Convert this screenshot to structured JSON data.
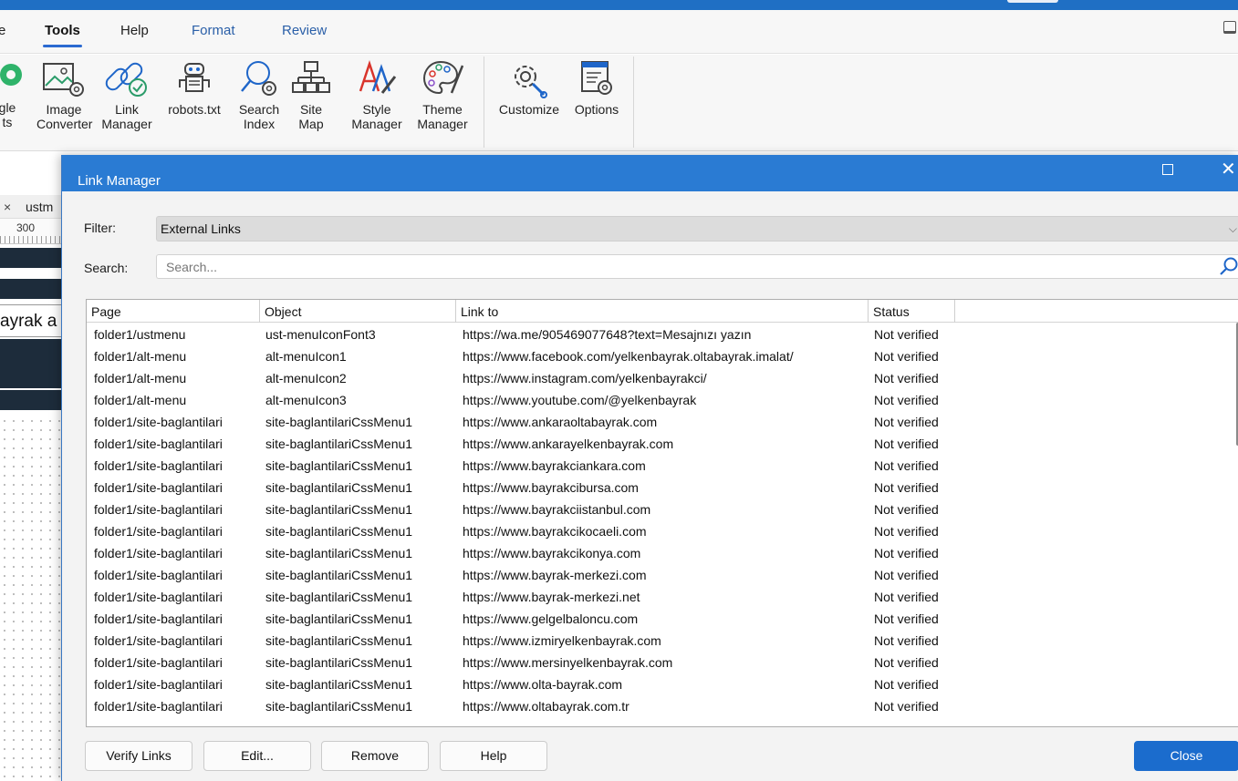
{
  "menu": {
    "tabs": [
      {
        "label": "e"
      },
      {
        "label": "Tools"
      },
      {
        "label": "Help"
      },
      {
        "label": "Format"
      },
      {
        "label": "Review"
      }
    ]
  },
  "ribbon": {
    "items": [
      {
        "label": "gle\nts",
        "icon": "google-fonts-icon"
      },
      {
        "label": "Image\nConverter",
        "icon": "image-converter-icon"
      },
      {
        "label": "Link\nManager",
        "icon": "link-manager-icon"
      },
      {
        "label": "robots.txt",
        "icon": "robot-icon"
      },
      {
        "label": "Search\nIndex",
        "icon": "search-index-icon"
      },
      {
        "label": "Site\nMap",
        "icon": "site-map-icon"
      },
      {
        "label": "Style\nManager",
        "icon": "style-manager-icon"
      },
      {
        "label": "Theme\nManager",
        "icon": "theme-manager-icon"
      },
      {
        "label": "Customize",
        "icon": "customize-icon"
      },
      {
        "label": "Options",
        "icon": "options-icon"
      }
    ]
  },
  "editor": {
    "doc_tab_close": "×",
    "doc_tab": "ustm",
    "ruler_mark": "300",
    "canvas_text": "ayrak a"
  },
  "dialog": {
    "title": "Link Manager",
    "filter_label": "Filter:",
    "filter_value": "External Links",
    "search_label": "Search:",
    "search_placeholder": "Search...",
    "columns": [
      "Page",
      "Object",
      "Link to",
      "Status"
    ],
    "rows": [
      [
        "folder1/ustmenu",
        "ust-menuIconFont3",
        "https://wa.me/905469077648?text=Mesajnızı yazın",
        "Not verified"
      ],
      [
        "folder1/alt-menu",
        "alt-menuIcon1",
        "https://www.facebook.com/yelkenbayrak.oltabayrak.imalat/",
        "Not verified"
      ],
      [
        "folder1/alt-menu",
        "alt-menuIcon2",
        "https://www.instagram.com/yelkenbayrakci/",
        "Not verified"
      ],
      [
        "folder1/alt-menu",
        "alt-menuIcon3",
        "https://www.youtube.com/@yelkenbayrak",
        "Not verified"
      ],
      [
        "folder1/site-baglantilari",
        "site-baglantilariCssMenu1",
        "https://www.ankaraoltabayrak.com",
        "Not verified"
      ],
      [
        "folder1/site-baglantilari",
        "site-baglantilariCssMenu1",
        "https://www.ankarayelkenbayrak.com",
        "Not verified"
      ],
      [
        "folder1/site-baglantilari",
        "site-baglantilariCssMenu1",
        "https://www.bayrakciankara.com",
        "Not verified"
      ],
      [
        "folder1/site-baglantilari",
        "site-baglantilariCssMenu1",
        "https://www.bayrakcibursa.com",
        "Not verified"
      ],
      [
        "folder1/site-baglantilari",
        "site-baglantilariCssMenu1",
        "https://www.bayrakciistanbul.com",
        "Not verified"
      ],
      [
        "folder1/site-baglantilari",
        "site-baglantilariCssMenu1",
        "https://www.bayrakcikocaeli.com",
        "Not verified"
      ],
      [
        "folder1/site-baglantilari",
        "site-baglantilariCssMenu1",
        "https://www.bayrakcikonya.com",
        "Not verified"
      ],
      [
        "folder1/site-baglantilari",
        "site-baglantilariCssMenu1",
        "https://www.bayrak-merkezi.com",
        "Not verified"
      ],
      [
        "folder1/site-baglantilari",
        "site-baglantilariCssMenu1",
        "https://www.bayrak-merkezi.net",
        "Not verified"
      ],
      [
        "folder1/site-baglantilari",
        "site-baglantilariCssMenu1",
        "https://www.gelgelbaloncu.com",
        "Not verified"
      ],
      [
        "folder1/site-baglantilari",
        "site-baglantilariCssMenu1",
        "https://www.izmiryelkenbayrak.com",
        "Not verified"
      ],
      [
        "folder1/site-baglantilari",
        "site-baglantilariCssMenu1",
        "https://www.mersinyelkenbayrak.com",
        "Not verified"
      ],
      [
        "folder1/site-baglantilari",
        "site-baglantilariCssMenu1",
        "https://www.olta-bayrak.com",
        "Not verified"
      ],
      [
        "folder1/site-baglantilari",
        "site-baglantilariCssMenu1",
        "https://www.oltabayrak.com.tr",
        "Not verified"
      ]
    ],
    "buttons": {
      "verify": "Verify Links",
      "edit": "Edit...",
      "remove": "Remove",
      "help": "Help",
      "close": "Close"
    }
  }
}
